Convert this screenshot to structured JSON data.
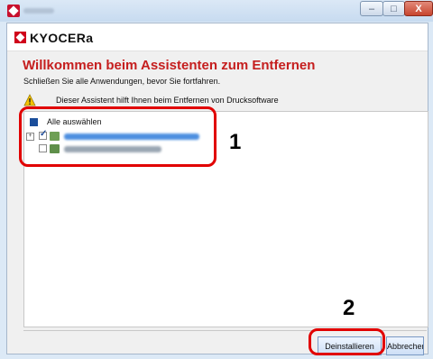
{
  "window": {
    "minimize_label": "–",
    "maximize_label": "□",
    "close_label": "X"
  },
  "brand": {
    "logo_text": "KYOCERa"
  },
  "wizard": {
    "heading": "Willkommen beim Assistenten zum Entfernen",
    "instruction": "Schließen Sie alle Anwendungen, bevor Sie fortfahren.",
    "info_text": "Dieser Assistent hilft Ihnen beim Entfernen von Drucksoftware"
  },
  "list": {
    "select_all_label": "Alle auswählen",
    "items": [
      {
        "expander": "+",
        "checked": true
      },
      {
        "checked": false
      }
    ]
  },
  "buttons": {
    "uninstall_label": "Deinstallieren",
    "cancel_label": "Abbrechen"
  },
  "annotations": {
    "step1": "1",
    "step2": "2"
  },
  "colors": {
    "accent_red": "#c51e1e",
    "highlight_red": "#e10000",
    "selection_blue": "#1b4e9b"
  }
}
